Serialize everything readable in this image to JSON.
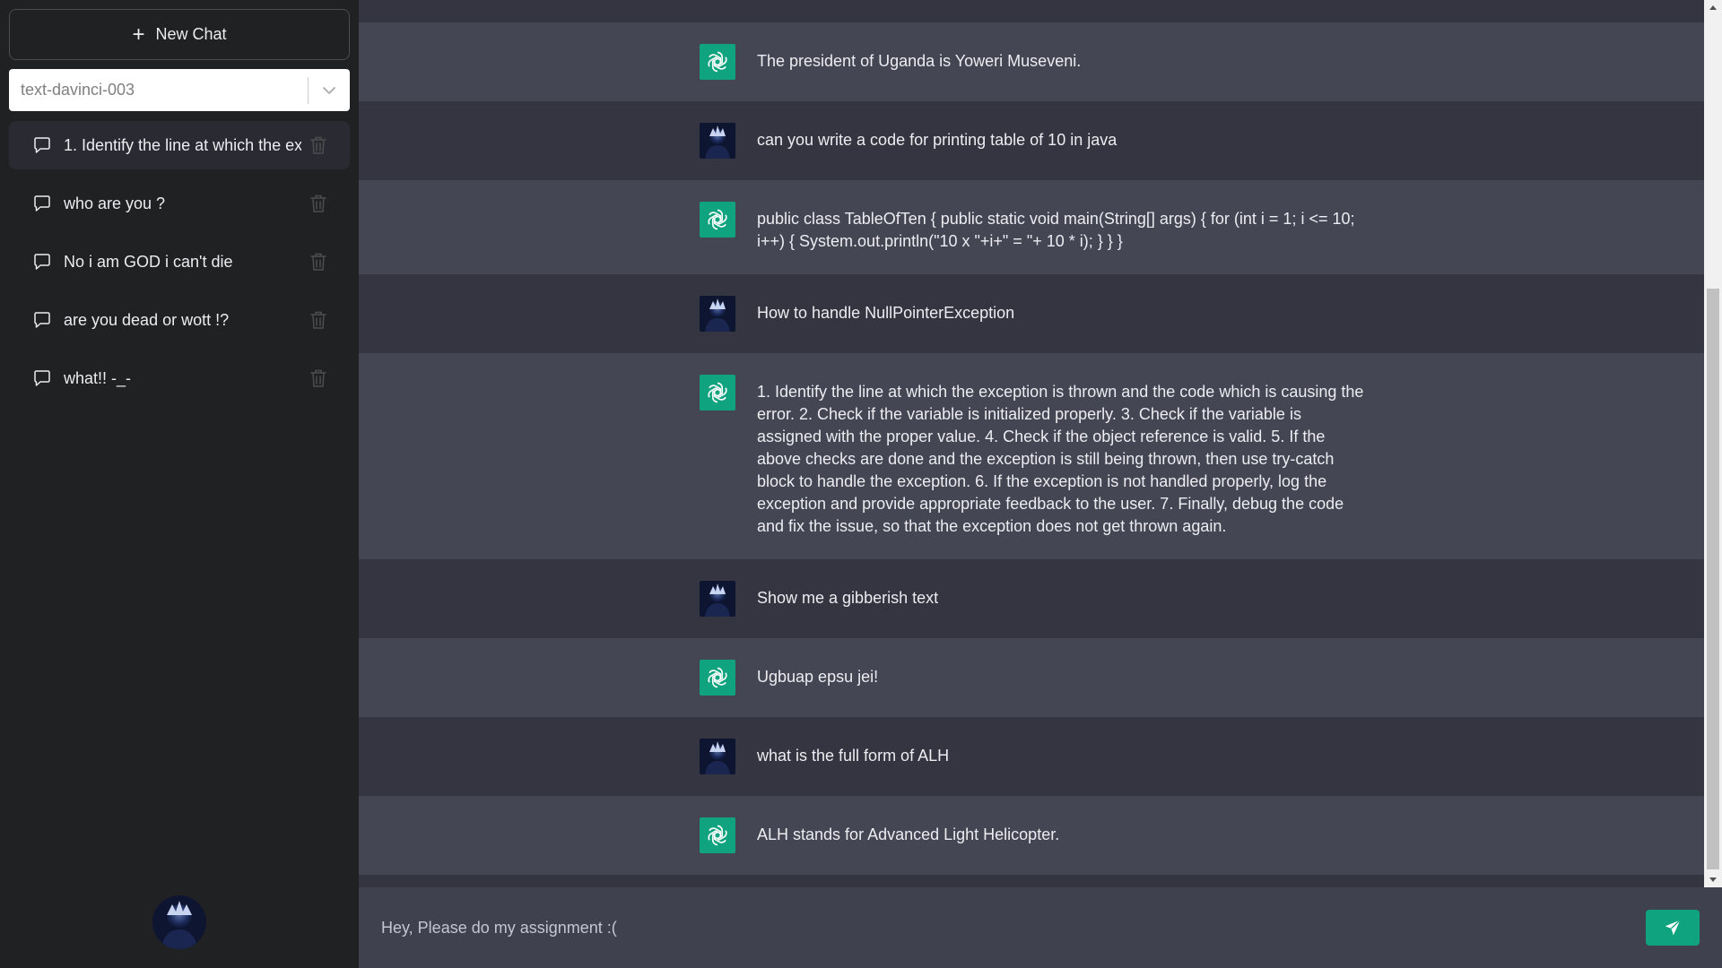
{
  "sidebar": {
    "new_chat_label": "New Chat",
    "model_select": {
      "selected": "text-davinci-003"
    },
    "chats": [
      {
        "label": "1. Identify the line at which the ex",
        "active": true
      },
      {
        "label": "who are you ?"
      },
      {
        "label": "No i am GOD i can't die"
      },
      {
        "label": "are you dead or wott !?"
      },
      {
        "label": "what!! -_-"
      }
    ]
  },
  "messages": [
    {
      "role": "bot",
      "text": "The president of Uganda is Yoweri Museveni."
    },
    {
      "role": "user",
      "text": "can you write a code for printing table of 10 in java"
    },
    {
      "role": "bot",
      "text": "public class TableOfTen { public static void main(String[] args) { for (int i = 1; i <= 10; i++) { System.out.println(\"10 x \"+i+\" = \"+ 10 * i); } } }"
    },
    {
      "role": "user",
      "text": "How to handle NullPointerException"
    },
    {
      "role": "bot",
      "text": "1. Identify the line at which the exception is thrown and the code which is causing the error. 2. Check if the variable is initialized properly. 3. Check if the variable is assigned with the proper value. 4. Check if the object reference is valid. 5. If the above checks are done and the exception is still being thrown, then use try-catch block to handle the exception. 6. If the exception is not handled properly, log the exception and provide appropriate feedback to the user. 7. Finally, debug the code and fix the issue, so that the exception does not get thrown again."
    },
    {
      "role": "user",
      "text": "Show me a gibberish text"
    },
    {
      "role": "bot",
      "text": "Ugbuap epsu jei!"
    },
    {
      "role": "user",
      "text": "what is the full form of ALH"
    },
    {
      "role": "bot",
      "text": "ALH stands for Advanced Light Helicopter."
    }
  ],
  "input": {
    "value": "Hey, Please do my assignment :("
  },
  "colors": {
    "sidebar_bg": "#202123",
    "main_bg": "#343541",
    "bot_row_bg": "#444654",
    "input_bg": "#40414f",
    "accent": "#10a37f"
  },
  "icons": {
    "new_chat": "plus-icon",
    "select": "chevron-down-icon",
    "chat": "chat-bubble-icon",
    "delete": "trash-icon",
    "bot": "openai-logo-icon",
    "send": "send-icon"
  }
}
